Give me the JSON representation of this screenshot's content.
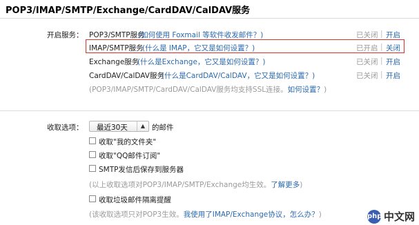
{
  "page": {
    "title": "POP3/IMAP/SMTP/Exchange/CardDAV/CalDAV服务"
  },
  "services": {
    "label": "开启服务：",
    "rows": [
      {
        "name": "POP3/SMTP服务",
        "help": "(如何使用 Foxmail 等软件收发邮件？)",
        "status": "已关闭",
        "sep": "|",
        "action": "开启"
      },
      {
        "name": "IMAP/SMTP服务",
        "help": "(什么是 IMAP，它又是如何设置？)",
        "status": "已开启",
        "sep": "|",
        "action": "关闭"
      },
      {
        "name": "Exchange服务",
        "help": "(什么是Exchange，它又是如何设置？)",
        "status": "已关闭",
        "sep": "|",
        "action": "开启"
      },
      {
        "name": "CardDAV/CalDAV服务",
        "help": "(什么是CardDAV/CalDAV，它又是如何设置？)",
        "status": "已关闭",
        "sep": "|",
        "action": "开启"
      }
    ],
    "ssl_note_prefix": "(POP3/IMAP/SMTP/CardDAV/CalDAV服务均支持SSL连接。",
    "ssl_note_link": "如何设置？",
    "ssl_note_suffix": ")"
  },
  "receive": {
    "label": "收取选项：",
    "select_value": "最近30天",
    "select_suffix": "的邮件",
    "checkboxes": [
      {
        "label": "收取\"我的文件夹\""
      },
      {
        "label": "收取\"QQ邮件订阅\""
      },
      {
        "label": "SMTP发信后保存到服务器"
      }
    ],
    "note1_prefix": "(以上收取选项对POP3/IMAP/SMTP/Exchange均生效。",
    "note1_link": "了解更多",
    "note1_suffix": ")",
    "spam_label": "收取垃圾邮件隔离提醒",
    "note2_prefix": "(该收取选项只对POP3生效。",
    "note2_link": "我使用了IMAP/Exchange协议，怎么办？",
    "note2_suffix": ")"
  },
  "watermark": {
    "logo": "php",
    "text": "中文网"
  }
}
